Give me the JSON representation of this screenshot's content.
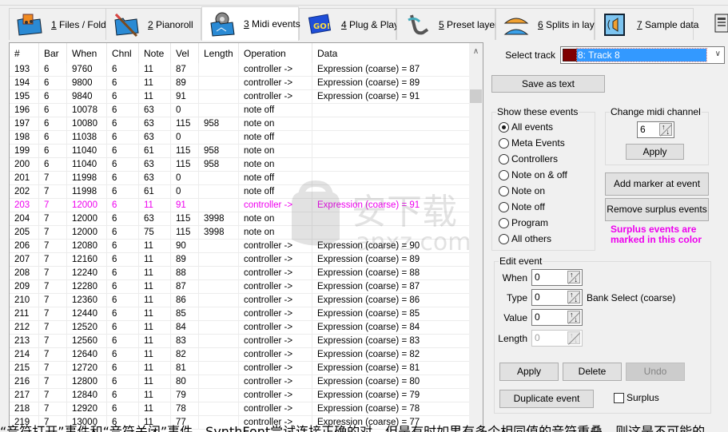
{
  "tabs": [
    {
      "num": "1",
      "label": " Files / Folders",
      "icon": "folder-music-icon",
      "active": false
    },
    {
      "num": "2",
      "label": " Pianoroll",
      "icon": "folder-pen-icon",
      "active": false
    },
    {
      "num": "3",
      "label": " Midi events",
      "icon": "folder-gear-icon",
      "active": true
    },
    {
      "num": "4",
      "label": " Plug & Play",
      "icon": "go-icon",
      "active": false
    },
    {
      "num": "5",
      "label": " Preset layers",
      "icon": "saxophone-icon",
      "active": false
    },
    {
      "num": "6",
      "label": " Splits in layer",
      "icon": "keyboard-split-icon",
      "active": false
    },
    {
      "num": "7",
      "label": " Sample data",
      "icon": "speaker-icon",
      "active": false
    }
  ],
  "table": {
    "columns": [
      "#",
      "Bar",
      "When",
      "Chnl",
      "Note",
      "Vel",
      "Length",
      "Operation",
      "Data"
    ],
    "rows": [
      {
        "n": "193",
        "bar": "6",
        "when": "9760",
        "ch": "6",
        "note": "11",
        "vel": "87",
        "len": "",
        "op": "controller ->",
        "data": "Expression (coarse) = 87",
        "surplus": false
      },
      {
        "n": "194",
        "bar": "6",
        "when": "9800",
        "ch": "6",
        "note": "11",
        "vel": "89",
        "len": "",
        "op": "controller ->",
        "data": "Expression (coarse) = 89",
        "surplus": false
      },
      {
        "n": "195",
        "bar": "6",
        "when": "9840",
        "ch": "6",
        "note": "11",
        "vel": "91",
        "len": "",
        "op": "controller ->",
        "data": "Expression (coarse) = 91",
        "surplus": false
      },
      {
        "n": "196",
        "bar": "6",
        "when": "10078",
        "ch": "6",
        "note": "63",
        "vel": "0",
        "len": "",
        "op": "note off",
        "data": "",
        "surplus": false
      },
      {
        "n": "197",
        "bar": "6",
        "when": "10080",
        "ch": "6",
        "note": "63",
        "vel": "115",
        "len": "958",
        "op": "note on",
        "data": "",
        "surplus": false
      },
      {
        "n": "198",
        "bar": "6",
        "when": "11038",
        "ch": "6",
        "note": "63",
        "vel": "0",
        "len": "",
        "op": "note off",
        "data": "",
        "surplus": false
      },
      {
        "n": "199",
        "bar": "6",
        "when": "11040",
        "ch": "6",
        "note": "61",
        "vel": "115",
        "len": "958",
        "op": "note on",
        "data": "",
        "surplus": false
      },
      {
        "n": "200",
        "bar": "6",
        "when": "11040",
        "ch": "6",
        "note": "63",
        "vel": "115",
        "len": "958",
        "op": "note on",
        "data": "",
        "surplus": false
      },
      {
        "n": "201",
        "bar": "7",
        "when": "11998",
        "ch": "6",
        "note": "63",
        "vel": "0",
        "len": "",
        "op": "note off",
        "data": "",
        "surplus": false
      },
      {
        "n": "202",
        "bar": "7",
        "when": "11998",
        "ch": "6",
        "note": "61",
        "vel": "0",
        "len": "",
        "op": "note off",
        "data": "",
        "surplus": false
      },
      {
        "n": "203",
        "bar": "7",
        "when": "12000",
        "ch": "6",
        "note": "11",
        "vel": "91",
        "len": "",
        "op": "controller ->",
        "data": "Expression (coarse) = 91",
        "surplus": true
      },
      {
        "n": "204",
        "bar": "7",
        "when": "12000",
        "ch": "6",
        "note": "63",
        "vel": "115",
        "len": "3998",
        "op": "note on",
        "data": "",
        "surplus": false
      },
      {
        "n": "205",
        "bar": "7",
        "when": "12000",
        "ch": "6",
        "note": "75",
        "vel": "115",
        "len": "3998",
        "op": "note on",
        "data": "",
        "surplus": false
      },
      {
        "n": "206",
        "bar": "7",
        "when": "12080",
        "ch": "6",
        "note": "11",
        "vel": "90",
        "len": "",
        "op": "controller ->",
        "data": "Expression (coarse) = 90",
        "surplus": false
      },
      {
        "n": "207",
        "bar": "7",
        "when": "12160",
        "ch": "6",
        "note": "11",
        "vel": "89",
        "len": "",
        "op": "controller ->",
        "data": "Expression (coarse) = 89",
        "surplus": false
      },
      {
        "n": "208",
        "bar": "7",
        "when": "12240",
        "ch": "6",
        "note": "11",
        "vel": "88",
        "len": "",
        "op": "controller ->",
        "data": "Expression (coarse) = 88",
        "surplus": false
      },
      {
        "n": "209",
        "bar": "7",
        "when": "12280",
        "ch": "6",
        "note": "11",
        "vel": "87",
        "len": "",
        "op": "controller ->",
        "data": "Expression (coarse) = 87",
        "surplus": false
      },
      {
        "n": "210",
        "bar": "7",
        "when": "12360",
        "ch": "6",
        "note": "11",
        "vel": "86",
        "len": "",
        "op": "controller ->",
        "data": "Expression (coarse) = 86",
        "surplus": false
      },
      {
        "n": "211",
        "bar": "7",
        "when": "12440",
        "ch": "6",
        "note": "11",
        "vel": "85",
        "len": "",
        "op": "controller ->",
        "data": "Expression (coarse) = 85",
        "surplus": false
      },
      {
        "n": "212",
        "bar": "7",
        "when": "12520",
        "ch": "6",
        "note": "11",
        "vel": "84",
        "len": "",
        "op": "controller ->",
        "data": "Expression (coarse) = 84",
        "surplus": false
      },
      {
        "n": "213",
        "bar": "7",
        "when": "12560",
        "ch": "6",
        "note": "11",
        "vel": "83",
        "len": "",
        "op": "controller ->",
        "data": "Expression (coarse) = 83",
        "surplus": false
      },
      {
        "n": "214",
        "bar": "7",
        "when": "12640",
        "ch": "6",
        "note": "11",
        "vel": "82",
        "len": "",
        "op": "controller ->",
        "data": "Expression (coarse) = 82",
        "surplus": false
      },
      {
        "n": "215",
        "bar": "7",
        "when": "12720",
        "ch": "6",
        "note": "11",
        "vel": "81",
        "len": "",
        "op": "controller ->",
        "data": "Expression (coarse) = 81",
        "surplus": false
      },
      {
        "n": "216",
        "bar": "7",
        "when": "12800",
        "ch": "6",
        "note": "11",
        "vel": "80",
        "len": "",
        "op": "controller ->",
        "data": "Expression (coarse) = 80",
        "surplus": false
      },
      {
        "n": "217",
        "bar": "7",
        "when": "12840",
        "ch": "6",
        "note": "11",
        "vel": "79",
        "len": "",
        "op": "controller ->",
        "data": "Expression (coarse) = 79",
        "surplus": false
      },
      {
        "n": "218",
        "bar": "7",
        "when": "12920",
        "ch": "6",
        "note": "11",
        "vel": "78",
        "len": "",
        "op": "controller ->",
        "data": "Expression (coarse) = 78",
        "surplus": false
      },
      {
        "n": "219",
        "bar": "7",
        "when": "13000",
        "ch": "6",
        "note": "11",
        "vel": "77",
        "len": "",
        "op": "controller ->",
        "data": "Expression (coarse) = 77",
        "surplus": false
      }
    ]
  },
  "panel": {
    "select_track_label": "Select track",
    "selected_track": "8: Track 8",
    "track_color": "#800000",
    "save_as_text": "Save as text",
    "show_events": {
      "title": "Show these events",
      "options": [
        "All events",
        "Meta Events",
        "Controllers",
        "Note on & off",
        "Note on",
        "Note off",
        "Program",
        "All others"
      ],
      "selected": "All events"
    },
    "change_channel": {
      "title": "Change midi channel",
      "value": "6",
      "apply": "Apply"
    },
    "add_marker": "Add marker at event",
    "remove_surplus": "Remove surplus events",
    "surplus_note_line1": "Surplus events are",
    "surplus_note_line2": "marked in this color",
    "surplus_color": "#ee00ee",
    "edit_event": {
      "title": "Edit event",
      "when_label": "When",
      "when_value": "0",
      "type_label": "Type",
      "type_value": "0",
      "type_desc": "Bank Select (coarse)",
      "value_label": "Value",
      "value_value": "0",
      "length_label": "Length",
      "length_value": "0",
      "apply": "Apply",
      "delete": "Delete",
      "undo": "Undo",
      "duplicate": "Duplicate event",
      "surplus_label": "Surplus",
      "surplus_checked": false
    }
  },
  "caption": "“音符打开”事件和“音符关闭”事件，SynthFont尝试连接正确的对，但是有时如果有多个相同值的音符重叠，则这是不可能的。"
}
